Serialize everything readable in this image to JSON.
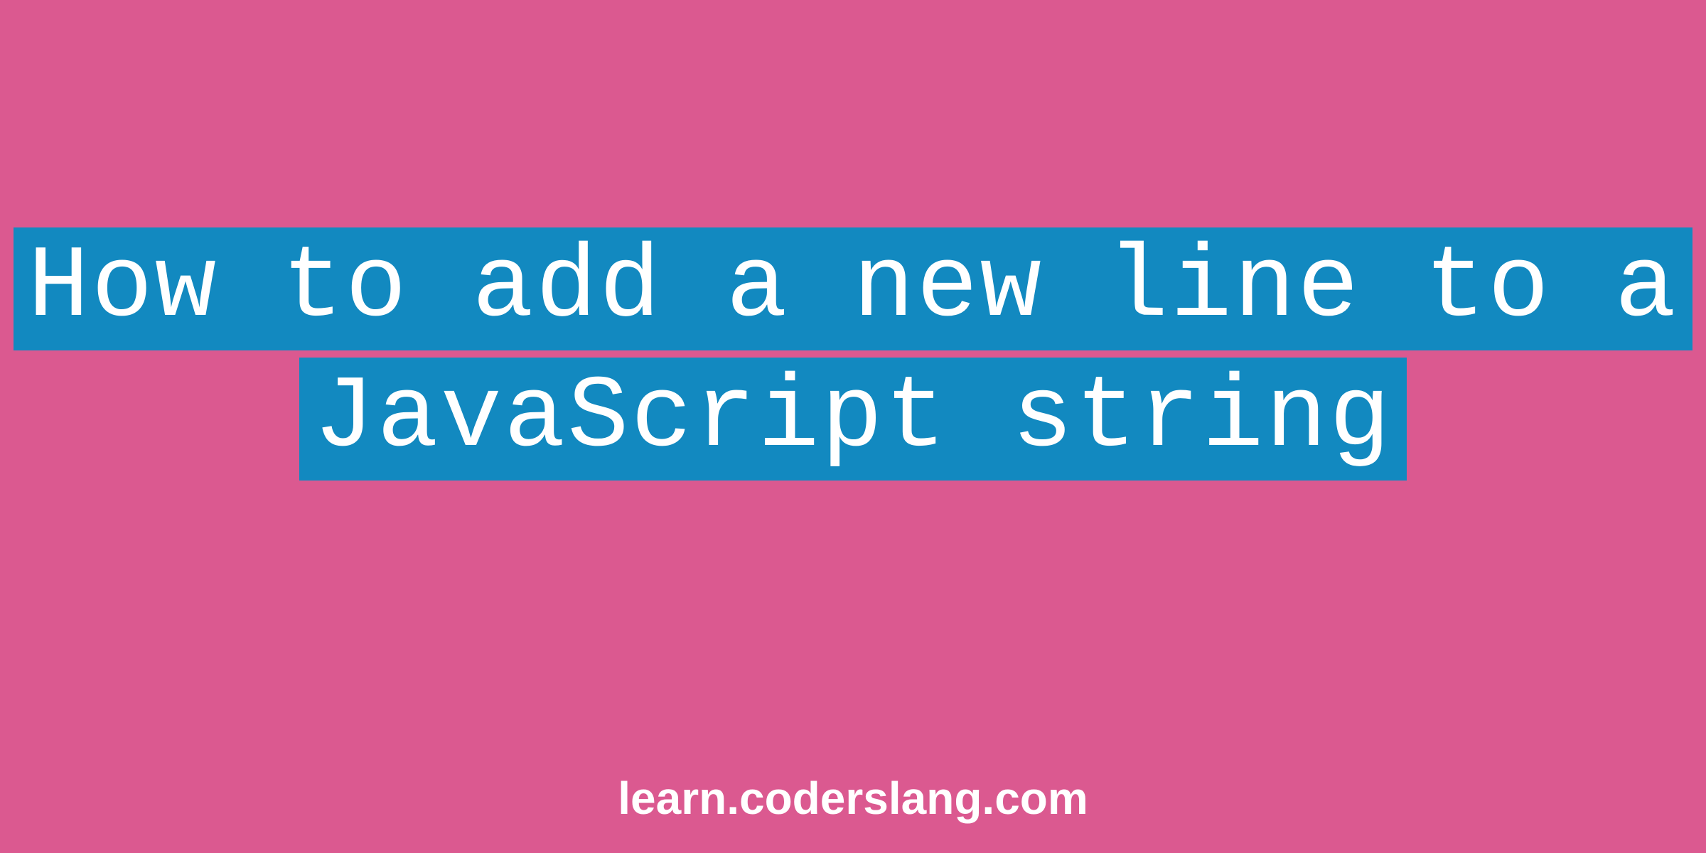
{
  "title": {
    "line1": "How to add a new line to a",
    "line2": " JavaScript string "
  },
  "footer": {
    "domain": "learn.coderslang.com"
  },
  "colors": {
    "background": "#db5990",
    "highlight": "#1289c0",
    "text": "#ffffff"
  }
}
